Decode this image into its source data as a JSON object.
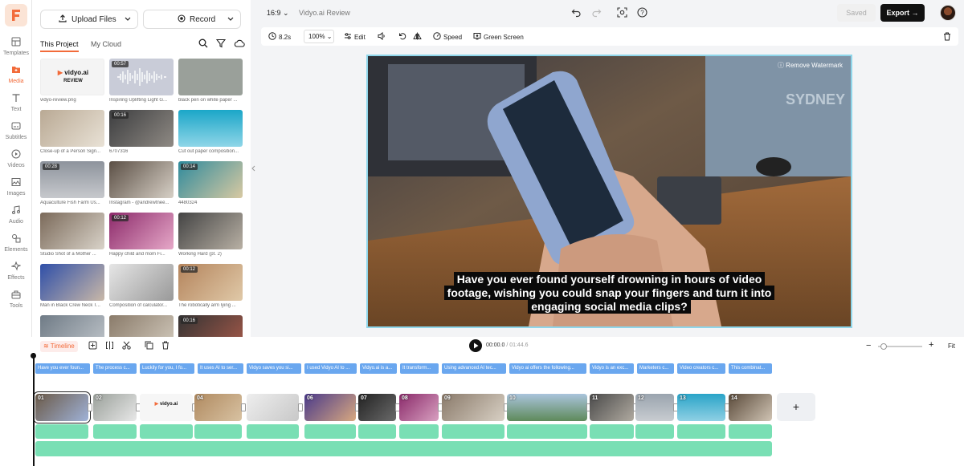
{
  "colors": {
    "accent": "#f26b3a",
    "subtitle_track": "#6aa7ef",
    "audio_track": "#79dfb4",
    "selection": "#8fd6ea"
  },
  "rail": [
    {
      "label": "Templates",
      "icon": "templates-icon"
    },
    {
      "label": "Media",
      "icon": "media-icon",
      "active": true
    },
    {
      "label": "Text",
      "icon": "text-icon"
    },
    {
      "label": "Subtitles",
      "icon": "subtitles-icon"
    },
    {
      "label": "Videos",
      "icon": "videos-icon"
    },
    {
      "label": "Images",
      "icon": "images-icon"
    },
    {
      "label": "Audio",
      "icon": "audio-icon"
    },
    {
      "label": "Elements",
      "icon": "elements-icon"
    },
    {
      "label": "Effects",
      "icon": "effects-icon"
    },
    {
      "label": "Tools",
      "icon": "tools-icon"
    }
  ],
  "panel": {
    "upload_label": "Upload Files",
    "record_label": "Record",
    "tabs": [
      "This Project",
      "My Cloud"
    ],
    "media": [
      {
        "caption": "vidyo-review.png",
        "duration": "",
        "logo": "vidyo.ai",
        "logo_sub": "REVIEW"
      },
      {
        "caption": "Inspiring Uplifting Light G...",
        "duration": "00:57"
      },
      {
        "caption": "black pen on white paper ...",
        "duration": ""
      },
      {
        "caption": "Close-up of a Person Sign...",
        "duration": ""
      },
      {
        "caption": "6707316",
        "duration": "00:16"
      },
      {
        "caption": "Cut out paper composition...",
        "duration": ""
      },
      {
        "caption": "Aquaculture Fish Farm Us...",
        "duration": "00:28"
      },
      {
        "caption": "Instagram - @andrewtnee...",
        "duration": ""
      },
      {
        "caption": "4480324",
        "duration": "00:14"
      },
      {
        "caption": "Studio Shot of a Mother ...",
        "duration": ""
      },
      {
        "caption": "Happy child and mom Fi...",
        "duration": "00:12"
      },
      {
        "caption": "Working Hard (pt. 2)",
        "duration": ""
      },
      {
        "caption": "Man in Black Crew Neck T...",
        "duration": ""
      },
      {
        "caption": "Composition of calculator...",
        "duration": ""
      },
      {
        "caption": "The robotically arm lying ...",
        "duration": "00:12"
      },
      {
        "caption": "",
        "duration": ""
      },
      {
        "caption": "",
        "duration": ""
      },
      {
        "caption": "",
        "duration": "00:16"
      }
    ]
  },
  "topbar": {
    "ratio": "16:9",
    "title": "Vidyo.ai Review",
    "saved": "Saved",
    "export": "Export"
  },
  "toolbar": {
    "duration": "8.2s",
    "zoom": "100%",
    "edit": "Edit",
    "speed": "Speed",
    "green_screen": "Green Screen"
  },
  "preview": {
    "watermark": "Remove Watermark",
    "subtitle_lines": [
      "Have you ever found yourself drowning in hours of video",
      "footage, wishing you could snap your fingers and turn it into",
      "engaging social media clips?"
    ]
  },
  "timeline": {
    "tab": "Timeline",
    "time_current": "00:00.0",
    "time_total": "/ 01:44.6",
    "fit": "Fit",
    "subtitles": [
      "Have you ever foun...",
      "The process c...",
      "Luckily for you, I fo...",
      "It uses AI to ser...",
      "Vidyo saves you si...",
      "I used Vidyo AI to ...",
      "Vidyo.ai is a...",
      "It transform...",
      "Using advanced AI tec...",
      "Vidyo ai offers the following...",
      "Vidyo is an exc...",
      "Marketers c...",
      "Video creators c...",
      "This combinat..."
    ],
    "clips": [
      "01",
      "02",
      "",
      "04",
      "",
      "06",
      "07",
      "08",
      "09",
      "10",
      "11",
      "12",
      "13",
      "14"
    ]
  }
}
